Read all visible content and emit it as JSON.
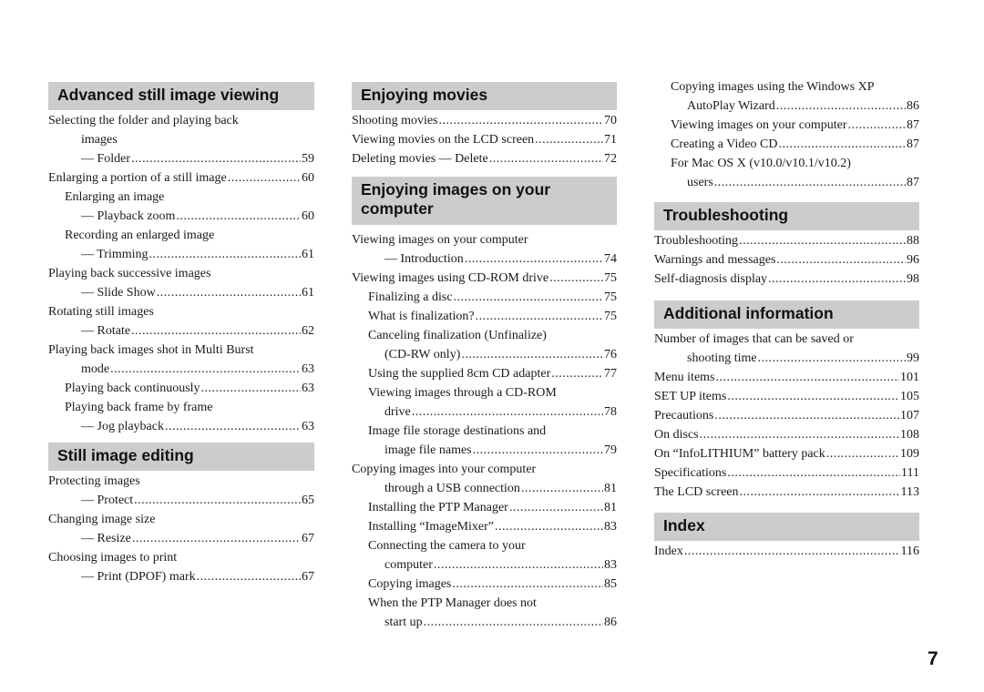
{
  "page_number": "7",
  "sections": [
    {
      "title": "Advanced still image viewing",
      "entries": [
        {
          "text": "Selecting the folder and playing back",
          "page": "",
          "indent": 0
        },
        {
          "text": "images",
          "page": "",
          "indent": 2
        },
        {
          "text": "— Folder",
          "page": "59",
          "indent": 2
        },
        {
          "text": "Enlarging a portion of a still image",
          "page": "60",
          "indent": 0
        },
        {
          "text": "Enlarging an image",
          "page": "",
          "indent": 1
        },
        {
          "text": "— Playback zoom",
          "page": "60",
          "indent": 2
        },
        {
          "text": "Recording an enlarged image",
          "page": "",
          "indent": 1
        },
        {
          "text": "— Trimming",
          "page": "61",
          "indent": 2
        },
        {
          "text": "Playing back successive images",
          "page": "",
          "indent": 0
        },
        {
          "text": "— Slide Show",
          "page": "61",
          "indent": 2
        },
        {
          "text": "Rotating still images",
          "page": "",
          "indent": 0
        },
        {
          "text": "— Rotate",
          "page": "62",
          "indent": 2
        },
        {
          "text": "Playing back images shot in Multi Burst",
          "page": "",
          "indent": 0
        },
        {
          "text": "mode",
          "page": "63",
          "indent": 2
        },
        {
          "text": "Playing back continuously",
          "page": "63",
          "indent": 1
        },
        {
          "text": "Playing back frame by frame",
          "page": "",
          "indent": 1
        },
        {
          "text": "— Jog playback",
          "page": "63",
          "indent": 2
        }
      ]
    },
    {
      "title": "Still image editing",
      "entries": [
        {
          "text": "Protecting images",
          "page": "",
          "indent": 0
        },
        {
          "text": "— Protect",
          "page": "65",
          "indent": 2
        },
        {
          "text": "Changing image size",
          "page": "",
          "indent": 0
        },
        {
          "text": "— Resize",
          "page": "67",
          "indent": 2
        },
        {
          "text": "Choosing images to print",
          "page": "",
          "indent": 0
        },
        {
          "text": "— Print (DPOF) mark",
          "page": "67",
          "indent": 2
        }
      ]
    },
    {
      "title": "Enjoying movies",
      "entries": [
        {
          "text": "Shooting movies",
          "page": "70",
          "indent": 0
        },
        {
          "text": "Viewing movies on the LCD screen",
          "page": "71",
          "indent": 0
        },
        {
          "text": "Deleting movies — Delete",
          "page": "72",
          "indent": 0
        }
      ]
    },
    {
      "title": "Enjoying images on your computer",
      "title_lines": [
        "Enjoying images on your",
        "computer"
      ],
      "entries": [
        {
          "text": "Viewing images on your computer",
          "page": "",
          "indent": 0
        },
        {
          "text": "— Introduction",
          "page": "74",
          "indent": 2
        },
        {
          "text": "Viewing images using CD-ROM drive",
          "page": "75",
          "indent": 0
        },
        {
          "text": "Finalizing a disc",
          "page": "75",
          "indent": 1
        },
        {
          "text": "What is finalization?",
          "page": "75",
          "indent": 1
        },
        {
          "text": "Canceling finalization (Unfinalize)",
          "page": "",
          "indent": 1
        },
        {
          "text": "(CD-RW only)",
          "page": "76",
          "indent": 2
        },
        {
          "text": "Using the supplied 8cm CD adapter",
          "page": "77",
          "indent": 1
        },
        {
          "text": "Viewing images through a CD-ROM",
          "page": "",
          "indent": 1
        },
        {
          "text": "drive",
          "page": "78",
          "indent": 2
        },
        {
          "text": "Image file storage destinations and",
          "page": "",
          "indent": 1
        },
        {
          "text": "image file names",
          "page": "79",
          "indent": 2
        },
        {
          "text": "Copying images into your computer",
          "page": "",
          "indent": 0
        },
        {
          "text": "through a USB connection",
          "page": "81",
          "indent": 2
        },
        {
          "text": "Installing the PTP Manager",
          "page": "81",
          "indent": 1
        },
        {
          "text": "Installing “ImageMixer”",
          "page": "83",
          "indent": 1
        },
        {
          "text": "Connecting the camera to your",
          "page": "",
          "indent": 1
        },
        {
          "text": "computer",
          "page": "83",
          "indent": 2
        },
        {
          "text": "Copying images",
          "page": "85",
          "indent": 1
        },
        {
          "text": "When the PTP Manager does not",
          "page": "",
          "indent": 1
        },
        {
          "text": "start up",
          "page": "86",
          "indent": 2
        },
        {
          "text": "Copying images using the Windows XP",
          "page": "",
          "indent": 1
        },
        {
          "text": "AutoPlay Wizard",
          "page": "86",
          "indent": 2
        },
        {
          "text": "Viewing images on your computer",
          "page": "87",
          "indent": 1
        },
        {
          "text": "Creating a Video CD",
          "page": "87",
          "indent": 1
        },
        {
          "text": "For Mac OS X (v10.0/v10.1/v10.2)",
          "page": "",
          "indent": 1
        },
        {
          "text": "users",
          "page": "87",
          "indent": 2
        }
      ]
    },
    {
      "title": "Troubleshooting",
      "entries": [
        {
          "text": "Troubleshooting",
          "page": "88",
          "indent": 0
        },
        {
          "text": "Warnings and messages",
          "page": "96",
          "indent": 0
        },
        {
          "text": "Self-diagnosis display",
          "page": "98",
          "indent": 0
        }
      ]
    },
    {
      "title": "Additional information",
      "entries": [
        {
          "text": "Number of images that can be saved or",
          "page": "",
          "indent": 0
        },
        {
          "text": "shooting time",
          "page": "99",
          "indent": 2
        },
        {
          "text": "Menu items",
          "page": "101",
          "indent": 0
        },
        {
          "text": "SET UP items",
          "page": "105",
          "indent": 0
        },
        {
          "text": "Precautions",
          "page": "107",
          "indent": 0
        },
        {
          "text": "On discs",
          "page": "108",
          "indent": 0
        },
        {
          "text": "On “InfoLITHIUM” battery pack",
          "page": "109",
          "indent": 0
        },
        {
          "text": "Specifications",
          "page": "111",
          "indent": 0
        },
        {
          "text": "The LCD screen",
          "page": "113",
          "indent": 0
        }
      ]
    },
    {
      "title": "Index",
      "entries": [
        {
          "text": "Index",
          "page": "116",
          "indent": 0
        }
      ]
    }
  ]
}
